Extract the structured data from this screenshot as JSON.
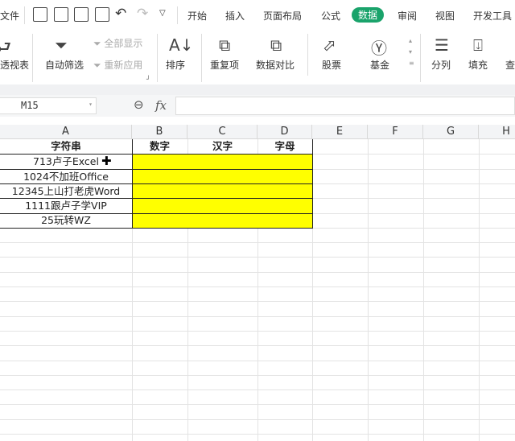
{
  "menu": {
    "file": "文件",
    "tabs": [
      "开始",
      "插入",
      "页面布局",
      "公式",
      "数据",
      "审阅",
      "视图",
      "开发工具"
    ],
    "active_tab": "数据"
  },
  "ribbon": {
    "pivot": "透视表",
    "autofilter": "自动筛选",
    "show_all": "全部显示",
    "reapply": "重新应用",
    "sort": "排序",
    "duplicates": "重复项",
    "compare": "数据对比",
    "stock": "股票",
    "fund": "基金",
    "split": "分列",
    "fill": "填充",
    "lookup": "查"
  },
  "formula_bar": {
    "name_box": "M15",
    "fx": "fx",
    "value": ""
  },
  "columns": [
    "A",
    "B",
    "C",
    "D",
    "E",
    "F",
    "G",
    "H"
  ],
  "sheet": {
    "headers": [
      "字符串",
      "数字",
      "汉字",
      "字母"
    ],
    "rows": [
      "713卢子Excel",
      "1024不加班Office",
      "12345上山打老虎Word",
      "1111跟卢子学VIP",
      "25玩转WZ"
    ]
  },
  "colors": {
    "accent": "#1aa36b",
    "highlight": "#ffff00"
  }
}
